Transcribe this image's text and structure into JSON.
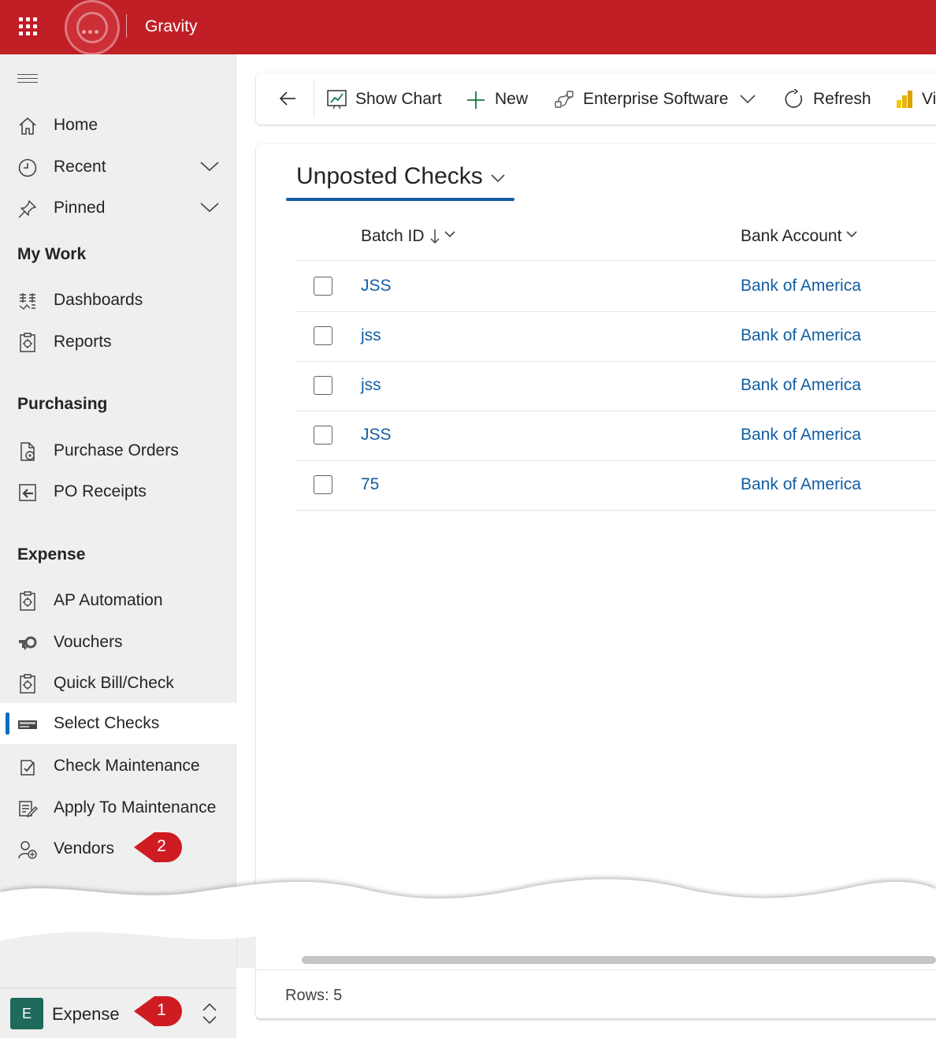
{
  "app": {
    "title": "Gravity"
  },
  "sidebar": {
    "nav": [
      {
        "label": "Home",
        "icon": "home-icon"
      },
      {
        "label": "Recent",
        "icon": "clock-icon"
      },
      {
        "label": "Pinned",
        "icon": "pin-icon"
      }
    ],
    "sections": [
      {
        "title": "My Work",
        "items": [
          {
            "label": "Dashboards"
          },
          {
            "label": "Reports"
          }
        ]
      },
      {
        "title": "Purchasing",
        "items": [
          {
            "label": "Purchase Orders"
          },
          {
            "label": "PO Receipts"
          }
        ]
      },
      {
        "title": "Expense",
        "items": [
          {
            "label": "AP Automation"
          },
          {
            "label": "Vouchers"
          },
          {
            "label": "Quick Bill/Check"
          },
          {
            "label": "Select Checks",
            "selected": true
          },
          {
            "label": "Check Maintenance"
          },
          {
            "label": "Apply To Maintenance"
          },
          {
            "label": "Vendors"
          }
        ]
      }
    ],
    "callout_vendors": "2",
    "area": {
      "avatar": "E",
      "label": "Expense",
      "callout": "1"
    }
  },
  "commandbar": {
    "items": [
      {
        "label": "Show Chart",
        "icon": "chart-icon"
      },
      {
        "label": "New",
        "icon": "plus-icon"
      },
      {
        "label": "Enterprise Software",
        "icon": "flow-icon"
      },
      {
        "label": "Refresh",
        "icon": "refresh-icon"
      },
      {
        "label": "Vi",
        "icon": "powerbi-icon"
      }
    ]
  },
  "view": {
    "title": "Unposted Checks",
    "columns": [
      {
        "label": "Batch ID"
      },
      {
        "label": "Bank Account"
      }
    ],
    "rows": [
      {
        "batch": "JSS",
        "bank": "Bank of America"
      },
      {
        "batch": "jss",
        "bank": "Bank of America"
      },
      {
        "batch": "jss",
        "bank": "Bank of America"
      },
      {
        "batch": "JSS",
        "bank": "Bank of America"
      },
      {
        "batch": "75",
        "bank": "Bank of America"
      }
    ],
    "rows_count": "Rows: 5"
  },
  "colors": {
    "brand": "#c01f26",
    "link": "#115ea3",
    "callout": "#cf1b22",
    "selected_bar": "#0f6cbd"
  }
}
